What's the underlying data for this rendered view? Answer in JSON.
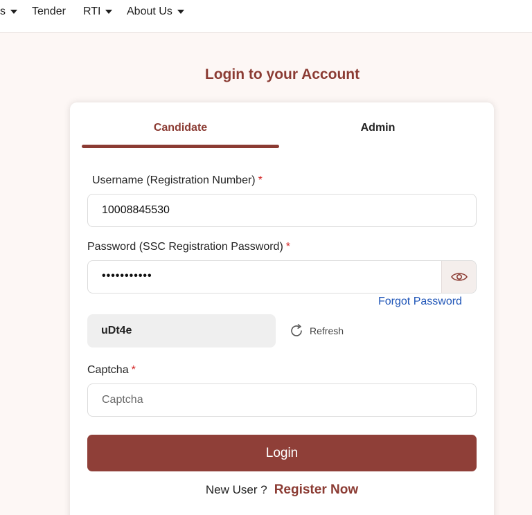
{
  "nav": {
    "items": [
      {
        "label": "s",
        "has_dropdown": true
      },
      {
        "label": "Tender",
        "has_dropdown": false
      },
      {
        "label": "RTI",
        "has_dropdown": true
      },
      {
        "label": "About Us",
        "has_dropdown": true
      }
    ]
  },
  "page": {
    "title": "Login to your Account"
  },
  "tabs": {
    "candidate": "Candidate",
    "admin": "Admin",
    "active": "Candidate"
  },
  "form": {
    "username_label": "Username (Registration Number)",
    "username_value": "10008845530",
    "password_label": "Password (SSC Registration Password)",
    "password_masked": "•••••••••••",
    "forgot_password": "Forgot Password",
    "captcha_code": "uDt4e",
    "refresh_label": "Refresh",
    "captcha_label": "Captcha",
    "captcha_placeholder": "Captcha",
    "required_mark": "*",
    "login_button": "Login",
    "new_user_text": "New User ?",
    "register_link": "Register Now"
  },
  "icons": {
    "eye": "eye-icon",
    "refresh": "refresh-icon",
    "caret": "caret-down-icon"
  },
  "colors": {
    "brand": "#8b3b33",
    "button": "#8f3f38",
    "link": "#2056b8",
    "required": "#d21f1f",
    "background": "#fdf7f5"
  }
}
